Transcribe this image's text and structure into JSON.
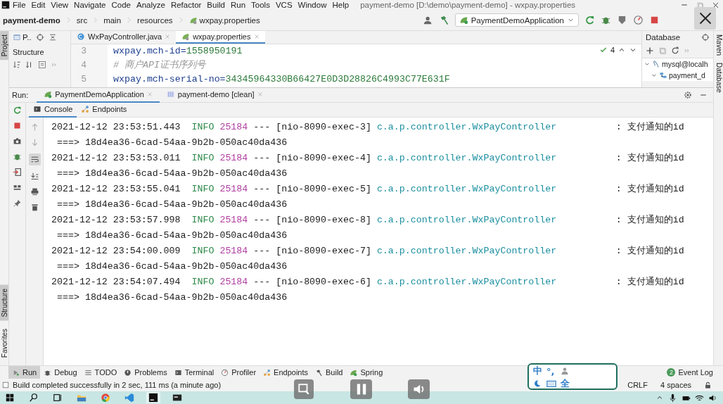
{
  "menu_bar": {
    "items": [
      "File",
      "Edit",
      "View",
      "Navigate",
      "Code",
      "Analyze",
      "Refactor",
      "Build",
      "Run",
      "Tools",
      "VCS",
      "Window",
      "Help"
    ],
    "title": "payment-demo [D:\\demo\\payment-demo] - wxpay.properties"
  },
  "breadcrumb": [
    "payment-demo",
    "src",
    "main",
    "resources",
    "wxpay.properties"
  ],
  "run_config": "PaymentDemoApplication",
  "left_stripe": {
    "top": [
      {
        "label": "Project",
        "selected": true
      }
    ],
    "bottom": [
      {
        "label": "Structure",
        "selected": true
      },
      {
        "label": "Favorites",
        "selected": false
      }
    ]
  },
  "project_panel": {
    "view": "P..",
    "structure_label": "Structure"
  },
  "editor": {
    "tabs": [
      {
        "label": "WxPayController.java",
        "selected": false,
        "kind": "java"
      },
      {
        "label": "wxpay.properties",
        "selected": true,
        "kind": "properties"
      }
    ],
    "lines": [
      {
        "number": "3",
        "kind": "property",
        "key": "wxpay.mch-id=",
        "value": "1558950191"
      },
      {
        "number": "4",
        "kind": "comment",
        "text": "# 商户API证书序列号"
      },
      {
        "number": "5",
        "kind": "property",
        "key": "wxpay.mch-serial-no=",
        "value": "34345964330B66427E0D3D28826C4993C77E631F"
      }
    ],
    "inspections": "4"
  },
  "database": {
    "title": "Database",
    "tree": [
      {
        "label": "mysql@localh",
        "kind": "datasource",
        "expanded": true,
        "children": [
          {
            "label": "payment_d",
            "kind": "schema",
            "expanded": true
          }
        ]
      }
    ]
  },
  "right_stripe": [
    {
      "label": "Maven"
    },
    {
      "label": "Database"
    }
  ],
  "run": {
    "label": "Run:",
    "tabs": [
      {
        "label": "PaymentDemoApplication",
        "selected": true,
        "kind": "spring"
      },
      {
        "label": "payment-demo [clean]",
        "selected": false,
        "kind": "maven"
      }
    ],
    "subtabs": [
      {
        "label": "Console",
        "selected": true,
        "kind": "console"
      },
      {
        "label": "Endpoints",
        "selected": false,
        "kind": "endpoints"
      }
    ],
    "log": [
      {
        "timestamp": "2021-12-12 23:53:51.443",
        "level": "INFO",
        "pid": "25184",
        "separator": "---",
        "thread": "[nio-8090-exec-3]",
        "logger": "c.a.p.controller.WxPayController",
        "message": ": 支付通知的id",
        "value": "===> 18d4ea36-6cad-54aa-9b2b-050ac40da436"
      },
      {
        "timestamp": "2021-12-12 23:53:53.011",
        "level": "INFO",
        "pid": "25184",
        "separator": "---",
        "thread": "[nio-8090-exec-4]",
        "logger": "c.a.p.controller.WxPayController",
        "message": ": 支付通知的id",
        "value": "===> 18d4ea36-6cad-54aa-9b2b-050ac40da436"
      },
      {
        "timestamp": "2021-12-12 23:53:55.041",
        "level": "INFO",
        "pid": "25184",
        "separator": "---",
        "thread": "[nio-8090-exec-5]",
        "logger": "c.a.p.controller.WxPayController",
        "message": ": 支付通知的id",
        "value": "===> 18d4ea36-6cad-54aa-9b2b-050ac40da436"
      },
      {
        "timestamp": "2021-12-12 23:53:57.998",
        "level": "INFO",
        "pid": "25184",
        "separator": "---",
        "thread": "[nio-8090-exec-8]",
        "logger": "c.a.p.controller.WxPayController",
        "message": ": 支付通知的id",
        "value": "===> 18d4ea36-6cad-54aa-9b2b-050ac40da436"
      },
      {
        "timestamp": "2021-12-12 23:54:00.009",
        "level": "INFO",
        "pid": "25184",
        "separator": "---",
        "thread": "[nio-8090-exec-7]",
        "logger": "c.a.p.controller.WxPayController",
        "message": ": 支付通知的id",
        "value": "===> 18d4ea36-6cad-54aa-9b2b-050ac40da436"
      },
      {
        "timestamp": "2021-12-12 23:54:07.494",
        "level": "INFO",
        "pid": "25184",
        "separator": "---",
        "thread": "[nio-8090-exec-6]",
        "logger": "c.a.p.controller.WxPayController",
        "message": ": 支付通知的id",
        "value": "===> 18d4ea36-6cad-54aa-9b2b-050ac40da436"
      }
    ]
  },
  "tool_windows": [
    {
      "label": "Run",
      "kind": "run",
      "selected": true
    },
    {
      "label": "Debug",
      "kind": "debug",
      "selected": false
    },
    {
      "label": "TODO",
      "kind": "todo",
      "selected": false
    },
    {
      "label": "Problems",
      "kind": "problems",
      "selected": false
    },
    {
      "label": "Terminal",
      "kind": "terminal",
      "selected": false
    },
    {
      "label": "Profiler",
      "kind": "profiler",
      "selected": false
    },
    {
      "label": "Endpoints",
      "kind": "endpoints",
      "selected": false
    },
    {
      "label": "Build",
      "kind": "build",
      "selected": false
    },
    {
      "label": "Spring",
      "kind": "spring",
      "selected": false
    }
  ],
  "event_log": {
    "label": "Event Log",
    "badge": "2"
  },
  "status_bar": {
    "message": "Build completed successfully in 2 sec, 111 ms (a minute ago)",
    "line_separator": "CRLF",
    "indent": "4 spaces"
  },
  "ime": {
    "mode": "中",
    "punctuation": "°,",
    "width": "全"
  }
}
